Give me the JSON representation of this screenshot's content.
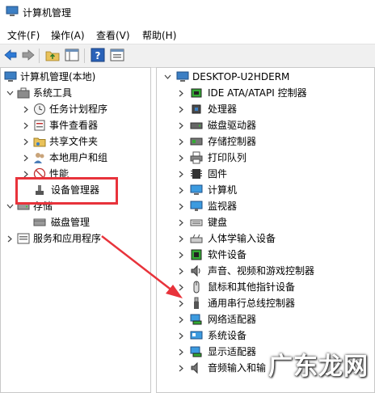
{
  "window": {
    "title": "计算机管理"
  },
  "menu": [
    "文件(F)",
    "操作(A)",
    "查看(V)",
    "帮助(H)"
  ],
  "toolbar": {
    "buttons": [
      "back-icon",
      "forward-icon",
      "up-folder-icon",
      "show-hide-tree-icon",
      "help-icon",
      "properties-icon"
    ]
  },
  "left_tree": {
    "root": "计算机管理(本地)",
    "system_tools": "系统工具",
    "task_scheduler": "任务计划程序",
    "event_viewer": "事件查看器",
    "shared_folders": "共享文件夹",
    "local_users": "本地用户和组",
    "performance": "性能",
    "device_manager": "设备管理器",
    "storage": "存储",
    "disk_management": "磁盘管理",
    "services": "服务和应用程序"
  },
  "device_tree": {
    "computer": "DESKTOP-U2HDERM",
    "categories": [
      "IDE ATA/ATAPI 控制器",
      "处理器",
      "磁盘驱动器",
      "存储控制器",
      "打印队列",
      "固件",
      "计算机",
      "监视器",
      "键盘",
      "人体学输入设备",
      "软件设备",
      "声音、视频和游戏控制器",
      "鼠标和其他指针设备",
      "通用串行总线控制器",
      "网络适配器",
      "系统设备",
      "显示适配器",
      "音频输入和输"
    ]
  },
  "watermark": "广东龙网",
  "colors": {
    "highlight": "#e8333b",
    "arrow": "#e8333b"
  }
}
